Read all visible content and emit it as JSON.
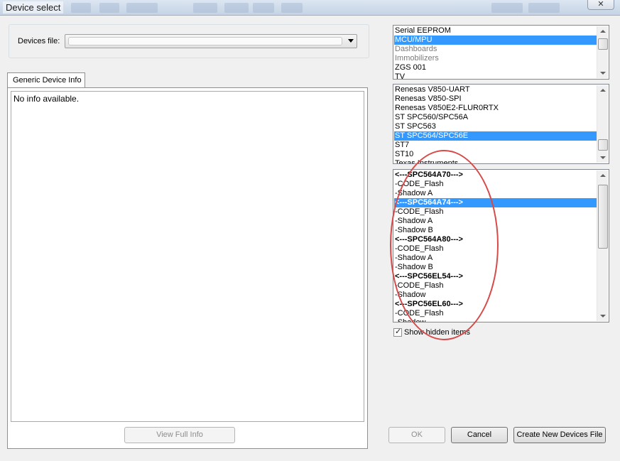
{
  "window": {
    "title": "Device select",
    "close_glyph": "✕"
  },
  "devices_file": {
    "label": "Devices file:",
    "value": ""
  },
  "tab": {
    "label": "Generic Device Info"
  },
  "info": {
    "text": "No info available."
  },
  "buttons": {
    "view_full_info": "View Full Info",
    "ok": "OK",
    "cancel": "Cancel",
    "create_new": "Create New Devices File"
  },
  "category_list": {
    "items": [
      {
        "label": "Serial EEPROM",
        "style": "normal"
      },
      {
        "label": "MCU/MPU",
        "style": "selected"
      },
      {
        "label": "Dashboards",
        "style": "gray"
      },
      {
        "label": "Immobilizers",
        "style": "gray"
      },
      {
        "label": "ZGS 001",
        "style": "normal"
      },
      {
        "label": "TV",
        "style": "normal"
      }
    ]
  },
  "family_list": {
    "items": [
      {
        "label": "Renesas V850-UART",
        "style": "normal"
      },
      {
        "label": "Renesas V850-SPI",
        "style": "normal"
      },
      {
        "label": "Renesas V850E2-FLUR0RTX",
        "style": "normal"
      },
      {
        "label": "ST SPC560/SPC56A",
        "style": "normal"
      },
      {
        "label": "ST SPC563",
        "style": "normal"
      },
      {
        "label": "ST SPC564/SPC56E",
        "style": "selected"
      },
      {
        "label": "ST7",
        "style": "normal"
      },
      {
        "label": "ST10",
        "style": "normal"
      },
      {
        "label": "Texas Instruments",
        "style": "normal"
      }
    ]
  },
  "device_list": {
    "items": [
      {
        "label": "<---SPC564A70--->",
        "style": "bold"
      },
      {
        "label": "-CODE_Flash",
        "style": "normal"
      },
      {
        "label": "-Shadow A",
        "style": "normal"
      },
      {
        "label": "<---SPC564A74--->",
        "style": "bold-selected"
      },
      {
        "label": "-CODE_Flash",
        "style": "normal"
      },
      {
        "label": "-Shadow A",
        "style": "normal"
      },
      {
        "label": "-Shadow B",
        "style": "normal"
      },
      {
        "label": "<---SPC564A80--->",
        "style": "bold"
      },
      {
        "label": "-CODE_Flash",
        "style": "normal"
      },
      {
        "label": "-Shadow A",
        "style": "normal"
      },
      {
        "label": "-Shadow B",
        "style": "normal"
      },
      {
        "label": "<---SPC56EL54--->",
        "style": "bold"
      },
      {
        "label": "-CODE_Flash",
        "style": "normal"
      },
      {
        "label": "-Shadow",
        "style": "normal"
      },
      {
        "label": "<---SPC56EL60--->",
        "style": "bold"
      },
      {
        "label": "-CODE_Flash",
        "style": "normal"
      },
      {
        "label": "-Shadow",
        "style": "normal"
      }
    ]
  },
  "show_hidden": {
    "label": "Show hidden items",
    "checked": true
  },
  "colors": {
    "selection": "#3399ff",
    "annotation": "#d64a4a"
  }
}
